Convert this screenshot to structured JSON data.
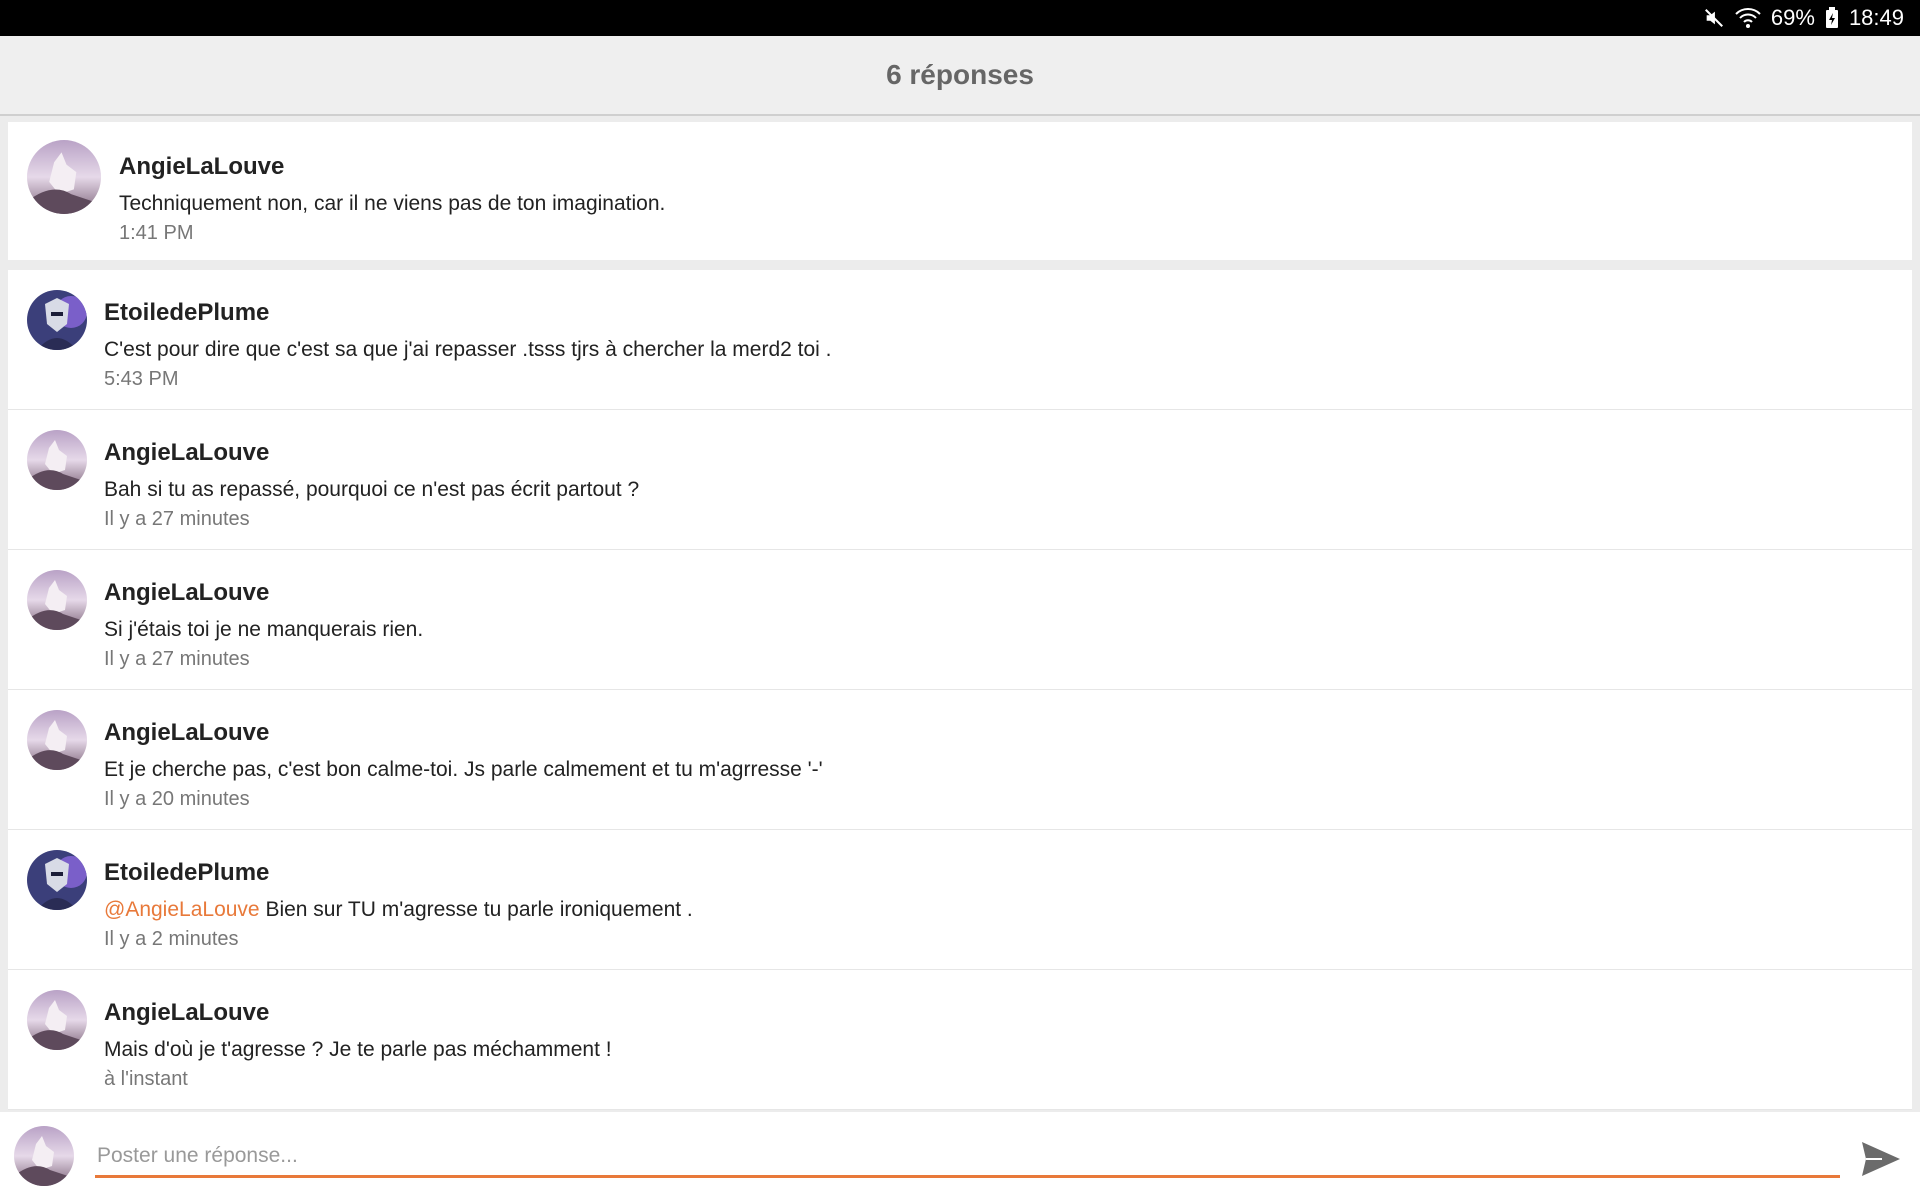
{
  "status_bar": {
    "battery": "69%",
    "time": "18:49"
  },
  "header": {
    "title": "6 réponses"
  },
  "parent_comment": {
    "author": "AngieLaLouve",
    "text": "Techniquement non, car il ne viens pas de ton imagination.",
    "time": "1:41 PM"
  },
  "replies": [
    {
      "author": "EtoiledePlume",
      "mention": "",
      "text": "C'est pour dire que c'est sa que j'ai repasser .tsss tjrs à chercher la merd2 toi .",
      "time": "5:43 PM"
    },
    {
      "author": "AngieLaLouve",
      "mention": "",
      "text": "Bah si tu as repassé, pourquoi ce n'est pas écrit partout ?",
      "time": "Il y a 27 minutes"
    },
    {
      "author": "AngieLaLouve",
      "mention": "",
      "text": "Si j'étais toi je ne manquerais rien.",
      "time": "Il y a 27 minutes"
    },
    {
      "author": "AngieLaLouve",
      "mention": "",
      "text": "Et je cherche pas, c'est bon calme-toi. Js parle calmement et tu m'agrresse '-'",
      "time": "Il y a 20 minutes"
    },
    {
      "author": "EtoiledePlume",
      "mention": "@AngieLaLouve",
      "text": " Bien sur TU m'agresse tu parle ironiquement .",
      "time": "Il y a 2 minutes"
    },
    {
      "author": "AngieLaLouve",
      "mention": "",
      "text": "Mais d'où je t'agresse ? Je te parle pas méchamment !",
      "time": "à l'instant"
    }
  ],
  "composer": {
    "placeholder": "Poster une réponse..."
  },
  "colors": {
    "accent": "#e8793a",
    "status_bar": "#000000",
    "header_bg": "#efefef"
  }
}
